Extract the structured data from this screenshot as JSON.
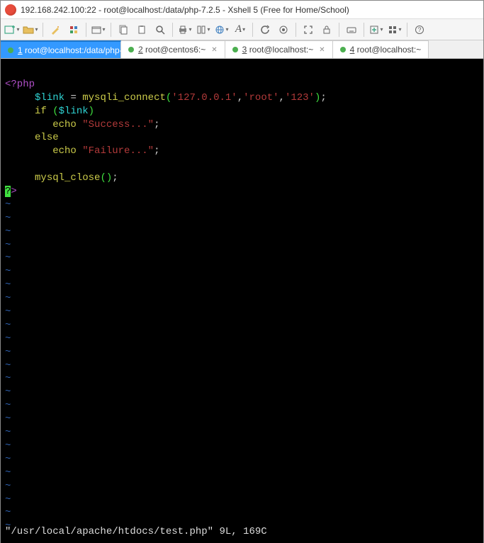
{
  "window": {
    "title": "192.168.242.100:22 - root@localhost:/data/php-7.2.5 - Xshell 5 (Free for Home/School)"
  },
  "toolbar_icons": {
    "new": "new-terminal",
    "open": "open-folder",
    "wand": "tool",
    "props": "properties",
    "copy_paste": "clipboard",
    "paste": "paste",
    "find": "search",
    "print": "print",
    "col": "split",
    "globe": "encoding",
    "font": "fonts",
    "refresh": "reconnect",
    "lock": "lock",
    "full": "fullscreen",
    "key": "keyboard",
    "add": "add-tab",
    "tile": "layout",
    "help": "help"
  },
  "tabs": [
    {
      "num": "1",
      "label": "root@localhost:/data/php-...",
      "active": true
    },
    {
      "num": "2",
      "label": "root@centos6:~",
      "active": false
    },
    {
      "num": "3",
      "label": "root@localhost:~",
      "active": false
    },
    {
      "num": "4",
      "label": "root@localhost:~",
      "active": false
    }
  ],
  "code": {
    "line1": "<?php",
    "var_link": "$link",
    "func_connect": "mysqli_connect",
    "str_host": "'127.0.0.1'",
    "str_user": "'root'",
    "str_pass": "'123'",
    "kw_if": "if",
    "kw_echo1": "echo",
    "str_success": "\"Success...\"",
    "kw_else": "else",
    "kw_echo2": "echo",
    "str_failure": "\"Failure...\"",
    "func_close": "mysql_close",
    "php_close_ql": "?",
    "php_close_gt": ">",
    "tilde": "~"
  },
  "status": "\"/usr/local/apache/htdocs/test.php\" 9L, 169C"
}
